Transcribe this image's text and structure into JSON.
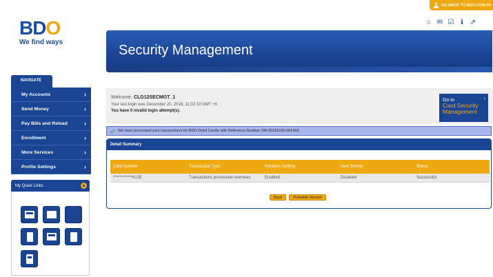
{
  "header": {
    "go_back_label": "GO BACK TO BDO.COM.PH",
    "logo_text_prefix": "BD",
    "logo_text_o": "O",
    "tagline": "We find ways",
    "icons": [
      "home-icon",
      "mail-icon",
      "checklist-icon",
      "info-icon",
      "share-icon"
    ]
  },
  "banner": {
    "title": "Security Management"
  },
  "sidebar": {
    "nav_tab": "NAVIGATE",
    "items": [
      {
        "label": "My Accounts"
      },
      {
        "label": "Send Money"
      },
      {
        "label": "Pay Bills and Reload"
      },
      {
        "label": "Enrollment"
      },
      {
        "label": "More Services"
      },
      {
        "label": "Profile Settings"
      }
    ],
    "chevron": "›",
    "quick_links_title": "My Quick Links"
  },
  "welcome": {
    "greeting": "Welcome, ",
    "username": "CLG12SECMGT_1",
    "last_login": "Your last login was December 20, 2018, 11:32:19 GMT +8",
    "invalid_attempts": "You have 0 invalid login attempt(s)."
  },
  "goto_card": {
    "line1": "Go to",
    "line2": "Card Security",
    "line3": "Management",
    "chevron": "›"
  },
  "message": {
    "text": "We have processed your transaction/s for BDO Debit Card/s with Reference Number SM-20181220-001450."
  },
  "detail": {
    "title": "Detail Summary",
    "columns": [
      "Card Number",
      "Transaction Type",
      "Previous Setting",
      "New Setting",
      "Status"
    ],
    "rows": [
      [
        "************6135",
        "Transactions processed overseas",
        "Enabled",
        "Disabled",
        "Successful"
      ]
    ],
    "back_label": "Back",
    "print_label": "Printable Version"
  },
  "colors": {
    "brand_blue": "#1a4494",
    "accent_gold": "#f0a810",
    "message_bg": "#a9b6ee"
  }
}
